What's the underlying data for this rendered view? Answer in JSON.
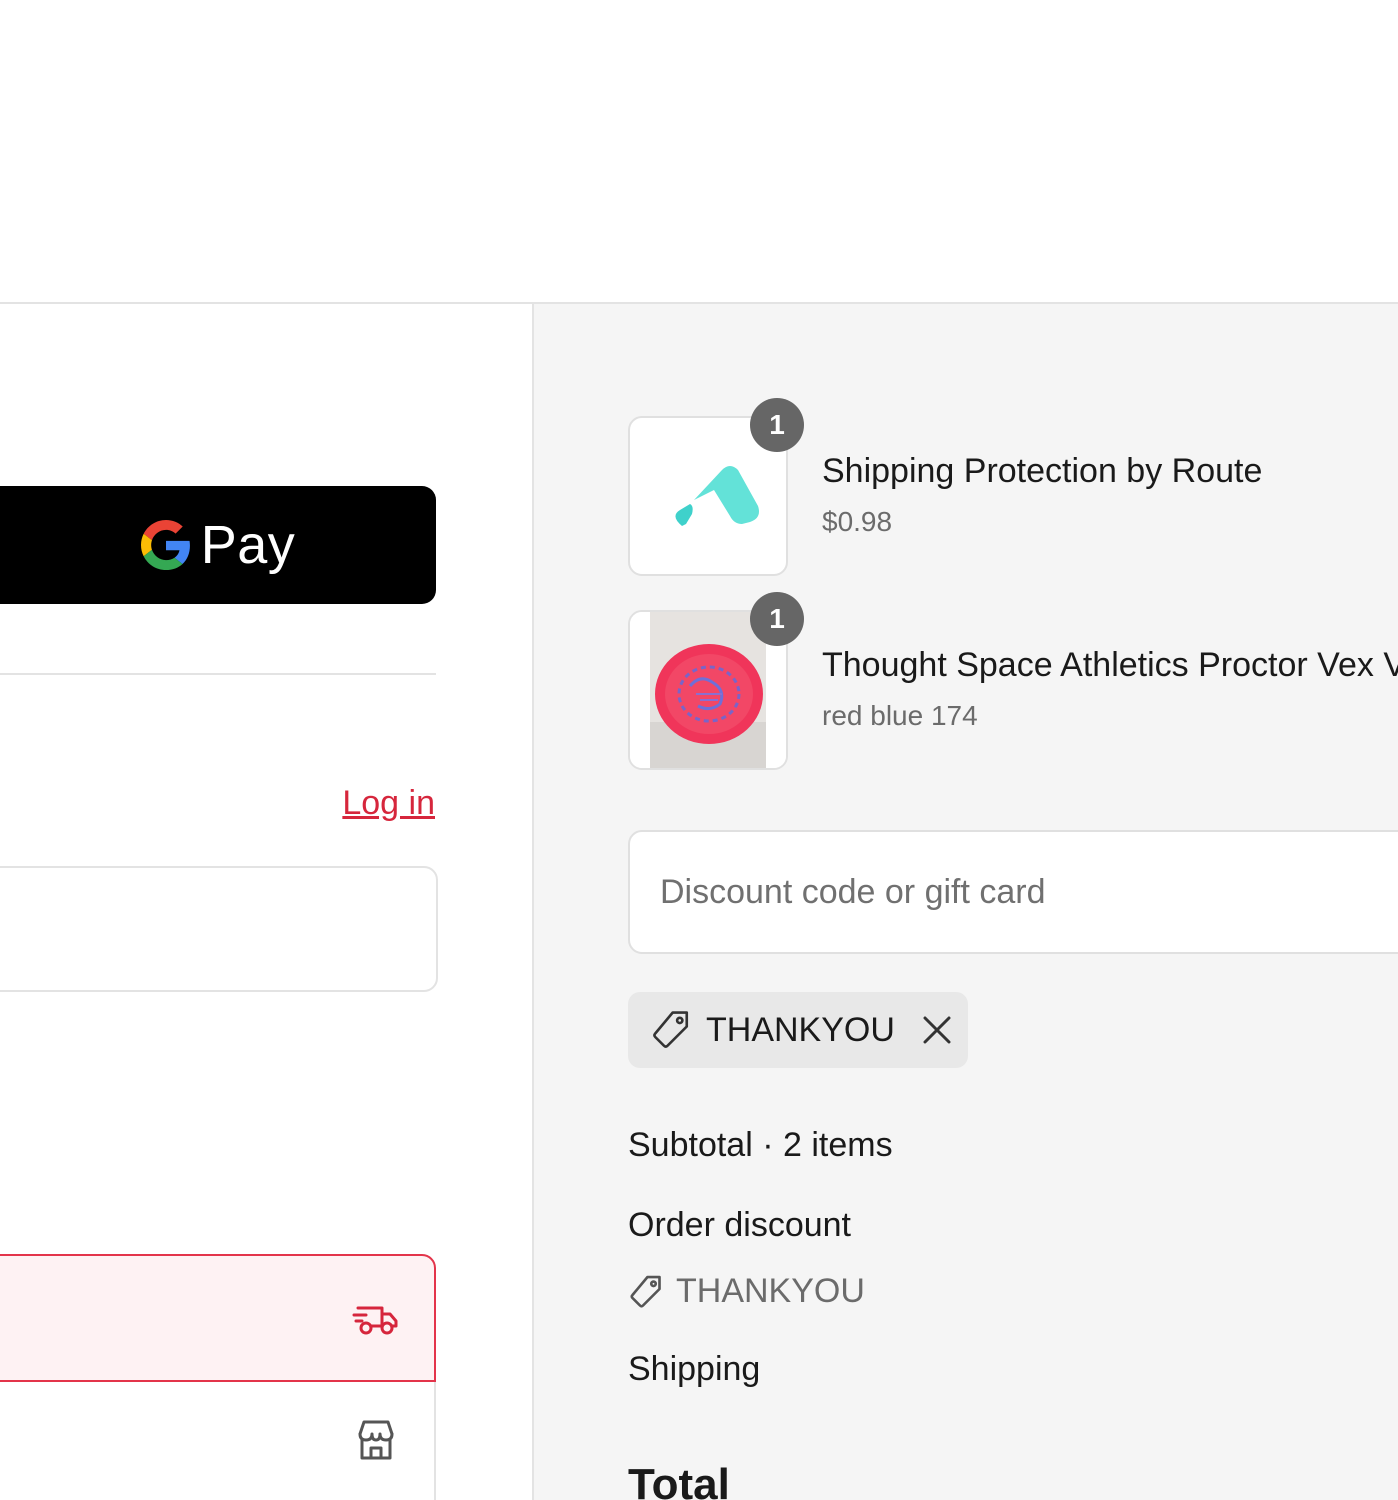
{
  "express_checkout": {
    "gpay_label": "Pay"
  },
  "contact": {
    "login_label": "Log in",
    "email_value": ""
  },
  "delivery": {
    "ship_icon": "delivery-truck-icon",
    "pickup_icon": "store-icon"
  },
  "order": {
    "items": [
      {
        "title": "Shipping Protection by Route",
        "subtitle": "$0.98",
        "quantity": "1",
        "image": "route-logo"
      },
      {
        "title": "Thought Space Athletics Proctor Vex V",
        "subtitle": "red blue 174",
        "quantity": "1",
        "image": "red-disc-photo"
      }
    ],
    "discount_placeholder": "Discount code or gift card",
    "applied_code": "THANKYOU",
    "summary": {
      "subtotal_label": "Subtotal · 2 items",
      "order_discount_label": "Order discount",
      "order_discount_code": "THANKYOU",
      "shipping_label": "Shipping",
      "total_label": "Total"
    }
  },
  "colors": {
    "accent": "#d6263c",
    "summary_bg": "#f5f5f5",
    "badge": "#666666"
  }
}
